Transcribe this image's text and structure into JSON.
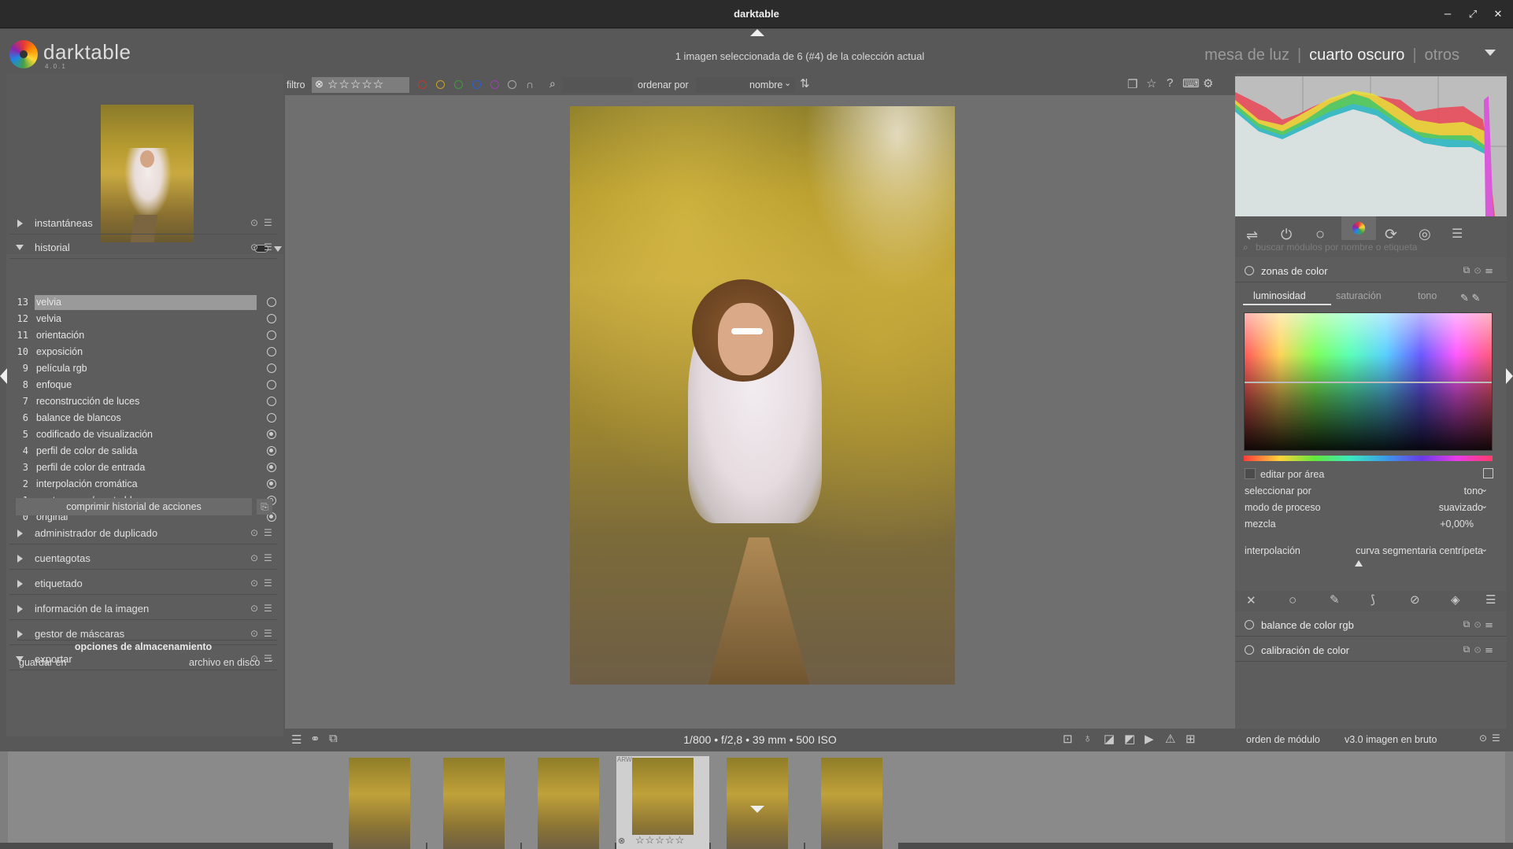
{
  "window": {
    "title": "darktable",
    "minimize": "–",
    "maximize": "⤢",
    "close": "✕"
  },
  "header": {
    "logo_text": "darktable",
    "logo_version": "4.0.1",
    "selection_info": "1 imagen seleccionada de 6 (#4) de la colección actual",
    "views": {
      "lighttable": "mesa de luz",
      "darkroom": "cuarto oscuro",
      "other": "otros",
      "separator": "|"
    }
  },
  "filterbar": {
    "filter_label": "filtro",
    "stars": "☆☆☆☆☆",
    "search_placeholder": "",
    "sort_label": "ordenar por",
    "sort_value": "nombre",
    "color_labels": [
      "#c0392b",
      "#c9a227",
      "#3e9b3e",
      "#2c5fd0",
      "#9b3fb0"
    ]
  },
  "left": {
    "sections_top": [
      {
        "label": "instantáneas"
      },
      {
        "label": "historial"
      }
    ],
    "history": [
      {
        "num": "13",
        "label": "velvia",
        "selected": true,
        "filled": false
      },
      {
        "num": "12",
        "label": "velvia",
        "filled": false
      },
      {
        "num": "11",
        "label": "orientación",
        "filled": false
      },
      {
        "num": "10",
        "label": "exposición",
        "filled": false
      },
      {
        "num": "9",
        "label": "película rgb",
        "filled": false
      },
      {
        "num": "8",
        "label": "enfoque",
        "filled": false
      },
      {
        "num": "7",
        "label": "reconstrucción de luces",
        "filled": false
      },
      {
        "num": "6",
        "label": "balance de blancos",
        "filled": false
      },
      {
        "num": "5",
        "label": "codificado de visualización",
        "filled": true
      },
      {
        "num": "4",
        "label": "perfil de color de salida",
        "filled": true
      },
      {
        "num": "3",
        "label": "perfil de color de entrada",
        "filled": true
      },
      {
        "num": "2",
        "label": "interpolación cromática",
        "filled": true
      },
      {
        "num": "1",
        "label": "punto negro / punto blanco",
        "filled": true
      },
      {
        "num": "0",
        "label": "original",
        "filled": true
      }
    ],
    "compress_label": "comprimir historial de acciones",
    "sections_bottom": [
      {
        "label": "administrador de duplicado"
      },
      {
        "label": "cuentagotas"
      },
      {
        "label": "etiquetado"
      },
      {
        "label": "información de la imagen"
      },
      {
        "label": "gestor de máscaras"
      },
      {
        "label": "exportar"
      }
    ],
    "storage_title": "opciones de almacenamiento",
    "save_label": "guardar en",
    "save_value": "archivo en disco"
  },
  "center": {
    "exif": "1/800 • f/2,8 • 39 mm • 500 ISO"
  },
  "right": {
    "search_placeholder": "buscar módulos por nombre o etiqueta",
    "module_name": "zonas de color",
    "tabs": [
      "luminosidad",
      "saturación",
      "tono"
    ],
    "edit_by_area": "editar por área",
    "rows": [
      {
        "label": "seleccionar por",
        "value": "tono"
      },
      {
        "label": "modo de proceso",
        "value": "suavizado"
      },
      {
        "label": "mezcla",
        "value": "+0,00%"
      },
      {
        "label": "interpolación",
        "value": "curva segmentaria centrípeta"
      }
    ],
    "mix_level": 0.5,
    "other_modules": [
      "balance de color rgb",
      "calibración de color"
    ],
    "bottom_left": "orden de módulo",
    "bottom_right": "v3.0 imagen en bruto"
  },
  "filmstrip": {
    "count": 6,
    "selected_index": 3,
    "badge": "ARW",
    "stars": "☆☆☆☆☆"
  }
}
